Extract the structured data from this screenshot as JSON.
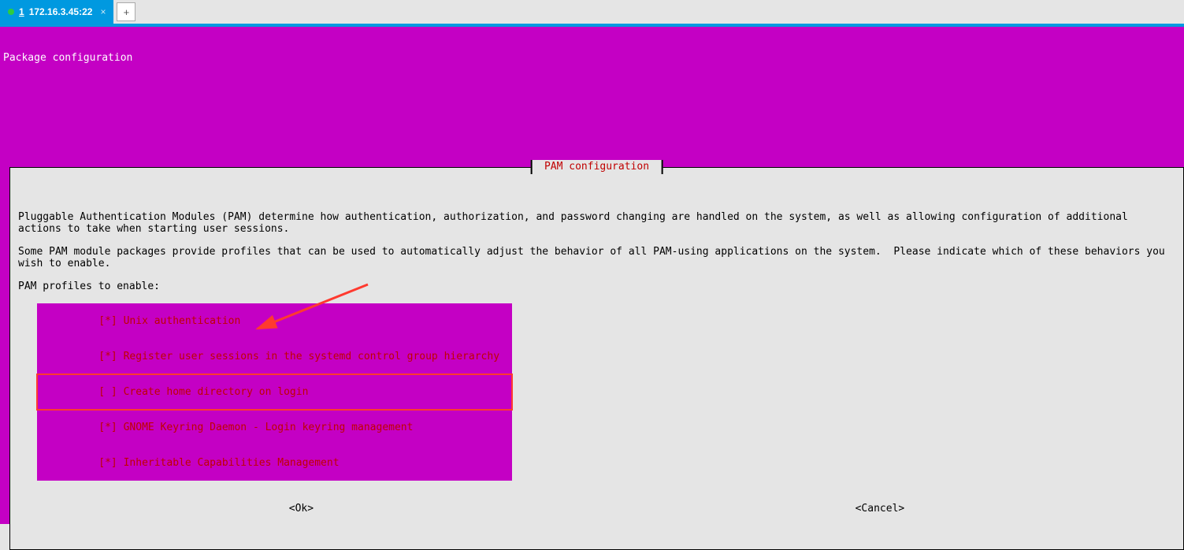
{
  "tab": {
    "index": "1",
    "label": "172.16.3.45:22",
    "close": "×",
    "add": "+"
  },
  "terminal": {
    "header": "Package configuration"
  },
  "dialog": {
    "title": " PAM configuration ",
    "para1": "Pluggable Authentication Modules (PAM) determine how authentication, authorization, and password changing are handled on the system, as well as allowing configuration of additional actions to take when starting user sessions.",
    "para2": "Some PAM module packages provide profiles that can be used to automatically adjust the behavior of all PAM-using applications on the system.  Please indicate which of these behaviors you wish to enable.",
    "prompt": "PAM profiles to enable:",
    "profiles": [
      {
        "checked": "[*]",
        "label": "Unix authentication",
        "highlighted": false
      },
      {
        "checked": "[*]",
        "label": "Register user sessions in the systemd control group hierarchy",
        "highlighted": false
      },
      {
        "checked": "[ ]",
        "label": "Create home directory on login",
        "highlighted": true
      },
      {
        "checked": "[*]",
        "label": "GNOME Keyring Daemon - Login keyring management",
        "highlighted": false
      },
      {
        "checked": "[*]",
        "label": "Inheritable Capabilities Management",
        "highlighted": false
      }
    ],
    "ok": "<Ok>",
    "cancel": "<Cancel>"
  }
}
